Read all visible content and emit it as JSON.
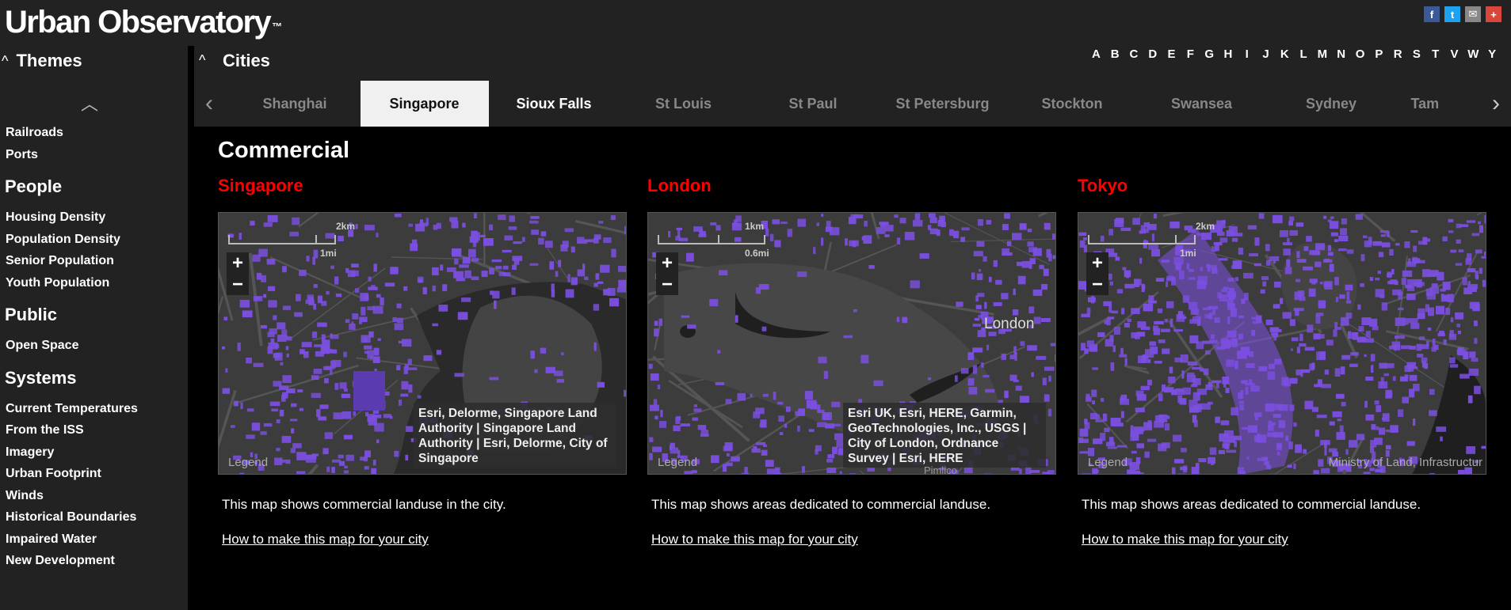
{
  "header": {
    "logo": "Urban Observatory",
    "trademark": "™",
    "social": [
      {
        "icon": "facebook-icon",
        "glyph": "f",
        "color": "#3b5998"
      },
      {
        "icon": "twitter-icon",
        "glyph": "t",
        "color": "#1da1f2"
      },
      {
        "icon": "email-icon",
        "glyph": "✉",
        "color": "#888888"
      },
      {
        "icon": "share-plus-icon",
        "glyph": "+",
        "color": "#d9473c"
      }
    ]
  },
  "sidebar": {
    "title": "Themes",
    "groups": [
      {
        "title": "",
        "items": [
          "Railroads",
          "Ports"
        ]
      },
      {
        "title": "People",
        "items": [
          "Housing Density",
          "Population Density",
          "Senior Population",
          "Youth Population"
        ]
      },
      {
        "title": "Public",
        "items": [
          "Open Space"
        ]
      },
      {
        "title": "Systems",
        "items": [
          "Current Temperatures",
          "From the ISS",
          "Imagery",
          "Urban Footprint",
          "Winds",
          "Historical Boundaries",
          "Impaired Water",
          "New Development"
        ]
      }
    ]
  },
  "cities": {
    "title": "Cities",
    "alphabet": [
      "A",
      "B",
      "C",
      "D",
      "E",
      "F",
      "G",
      "H",
      "I",
      "J",
      "K",
      "L",
      "M",
      "N",
      "O",
      "P",
      "R",
      "S",
      "T",
      "V",
      "W",
      "Y"
    ],
    "tabs": [
      {
        "label": "Shanghai",
        "state": "dim"
      },
      {
        "label": "Singapore",
        "state": "active"
      },
      {
        "label": "Sioux Falls",
        "state": "bright"
      },
      {
        "label": "St Louis",
        "state": "dim"
      },
      {
        "label": "St Paul",
        "state": "dim"
      },
      {
        "label": "St Petersburg",
        "state": "dim"
      },
      {
        "label": "Stockton",
        "state": "dim"
      },
      {
        "label": "Swansea",
        "state": "dim"
      },
      {
        "label": "Sydney",
        "state": "dim"
      },
      {
        "label": "Tam",
        "state": "dim"
      }
    ]
  },
  "content": {
    "title": "Commercial",
    "cards": [
      {
        "city": "Singapore",
        "scale_top": "2km",
        "scale_bottom": "1mi",
        "legend": "Legend",
        "attribution": "Esri, Delorme, Singapore Land Authority | Singapore Land Authority | Esri, Delorme, City of Singapore",
        "map_label": "",
        "description": "This map shows commercial landuse in the city.",
        "link": "How to make this map for your city"
      },
      {
        "city": "London",
        "scale_top": "1km",
        "scale_bottom": "0.6mi",
        "legend": "Legend",
        "attribution": "Esri UK, Esri, HERE, Garmin, GeoTechnologies, Inc., USGS | City of London, Ordnance Survey | Esri, HERE",
        "map_label": "London",
        "map_label_2": "Pimlico",
        "description": "This map shows areas dedicated to commercial landuse.",
        "link": "How to make this map for your city"
      },
      {
        "city": "Tokyo",
        "scale_top": "2km",
        "scale_bottom": "1mi",
        "legend": "Legend",
        "attribution": "Ministry of Land, Infrastructur",
        "map_label": "",
        "description": "This map shows areas dedicated to commercial landuse.",
        "link": "How to make this map for your city"
      }
    ],
    "zoom_in": "+",
    "zoom_out": "−"
  },
  "colors": {
    "commercial": "#7b4fe0",
    "map_bg": "#3a3a3a",
    "city_title": "#ff0000"
  }
}
